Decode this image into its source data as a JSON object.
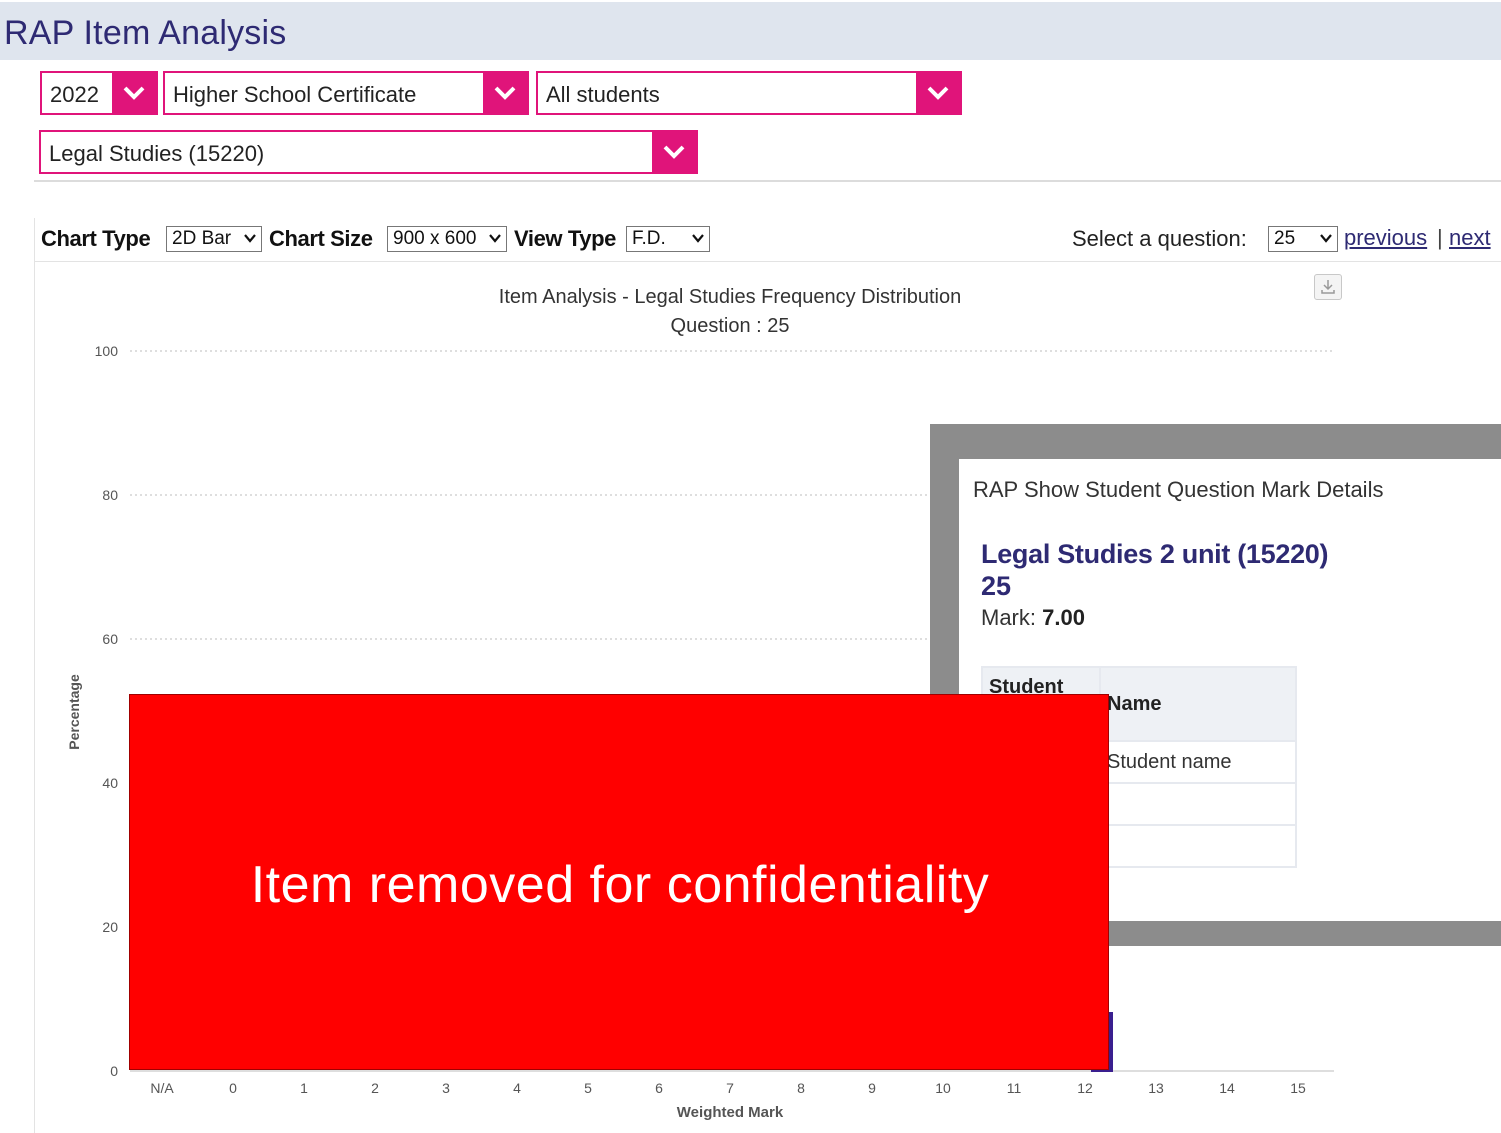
{
  "header": {
    "title": "RAP Item Analysis"
  },
  "filters": {
    "year": "2022",
    "exam": "Higher School Certificate",
    "group": "All students",
    "course": "Legal Studies (15220)"
  },
  "toolbar": {
    "chart_type_label": "Chart Type",
    "chart_type_value": "2D Bar",
    "chart_size_label": "Chart Size",
    "chart_size_value": "900 x 600",
    "view_type_label": "View Type",
    "view_type_value": "F.D.",
    "question_label": "Select a question:",
    "question_value": "25",
    "previous_label": "previous",
    "separator": "|",
    "next_label": "next"
  },
  "chart_data": {
    "type": "bar",
    "title": "Item Analysis - Legal Studies Frequency Distribution",
    "subtitle": "Question : 25",
    "xlabel": "Weighted Mark",
    "ylabel": "Percentage",
    "ylim": [
      0,
      100
    ],
    "yticks": [
      0,
      20,
      40,
      60,
      80,
      100
    ],
    "categories": [
      "N/A",
      "0",
      "1",
      "2",
      "3",
      "4",
      "5",
      "6",
      "7",
      "8",
      "9",
      "10",
      "11",
      "12",
      "13",
      "14",
      "15"
    ],
    "grid": true,
    "bar_color": "#3a1f8f"
  },
  "popup": {
    "title": "RAP Show Student Question Mark Details",
    "course": "Legal Studies 2 unit (15220)",
    "question": "25",
    "mark_label": "Mark:",
    "mark_value": "7.00",
    "table": {
      "headers": [
        "Student",
        "Name"
      ],
      "rows": [
        [
          "",
          "Student name"
        ],
        [
          "",
          ""
        ],
        [
          "",
          ""
        ]
      ]
    }
  },
  "redaction": {
    "text": "Item removed for confidentiality"
  },
  "colors": {
    "accent": "#e0147a",
    "brand": "#2e2a73",
    "redaction": "#ff0000"
  }
}
